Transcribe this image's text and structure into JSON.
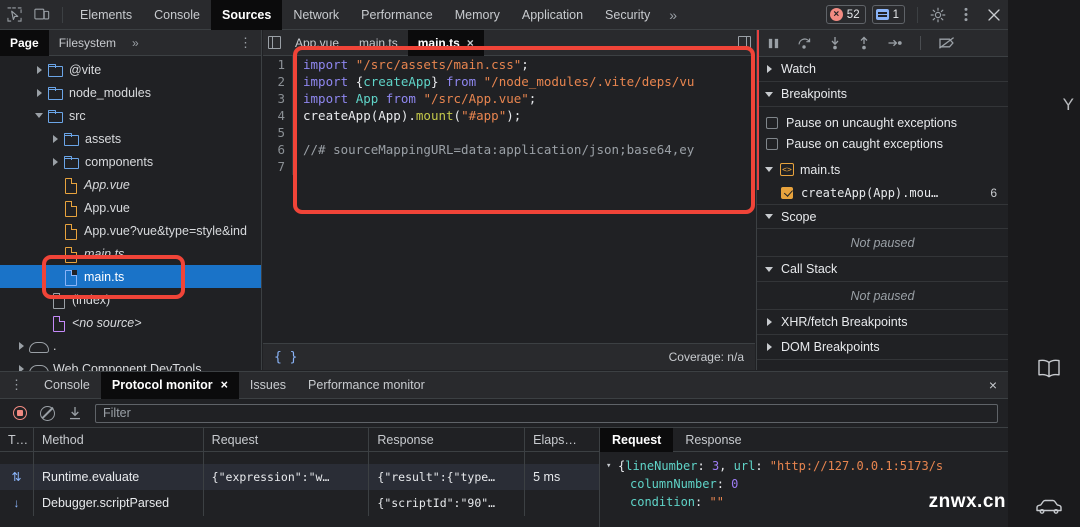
{
  "topbar": {
    "icons": [
      "inspect-icon",
      "device-toggle-icon"
    ],
    "tabs": [
      {
        "label": "Elements",
        "active": false
      },
      {
        "label": "Console",
        "active": false
      },
      {
        "label": "Sources",
        "active": true
      },
      {
        "label": "Network",
        "active": false
      },
      {
        "label": "Performance",
        "active": false
      },
      {
        "label": "Memory",
        "active": false
      },
      {
        "label": "Application",
        "active": false
      },
      {
        "label": "Security",
        "active": false
      }
    ],
    "more": "»",
    "error_count": "52",
    "message_count": "1",
    "settings_icon": "gear-icon",
    "menu_icon": "kebab-menu-icon",
    "close_icon": "close-icon"
  },
  "navigator": {
    "tabs": [
      {
        "label": "Page",
        "active": true
      },
      {
        "label": "Filesystem",
        "active": false
      }
    ],
    "more": "»",
    "menu": "⋮",
    "tree": [
      {
        "label": "@vite",
        "type": "folder",
        "arrow": "closed",
        "indent": 34,
        "selected": false,
        "italic": false
      },
      {
        "label": "node_modules",
        "type": "folder",
        "arrow": "closed",
        "indent": 34,
        "selected": false,
        "italic": false
      },
      {
        "label": "src",
        "type": "folder",
        "arrow": "open",
        "indent": 34,
        "selected": false,
        "italic": false
      },
      {
        "label": "assets",
        "type": "folder",
        "arrow": "closed",
        "indent": 50,
        "selected": false,
        "italic": false
      },
      {
        "label": "components",
        "type": "folder",
        "arrow": "closed",
        "indent": 50,
        "selected": false,
        "italic": false
      },
      {
        "label": "App.vue",
        "type": "doc-orange",
        "arrow": "none",
        "indent": 62,
        "selected": false,
        "italic": true
      },
      {
        "label": "App.vue",
        "type": "doc-orange",
        "arrow": "none",
        "indent": 62,
        "selected": false,
        "italic": false
      },
      {
        "label": "App.vue?vue&type=style&ind",
        "type": "doc-orange",
        "arrow": "none",
        "indent": 62,
        "selected": false,
        "italic": false
      },
      {
        "label": "main.ts",
        "type": "doc-orange",
        "arrow": "none",
        "indent": 62,
        "selected": false,
        "italic": true
      },
      {
        "label": "main.ts",
        "type": "doc-blue",
        "arrow": "none",
        "indent": 62,
        "selected": true,
        "italic": false
      },
      {
        "label": "(index)",
        "type": "doc-grey",
        "arrow": "none",
        "indent": 50,
        "selected": false,
        "italic": false
      },
      {
        "label": "<no source>",
        "type": "doc-purple",
        "arrow": "none",
        "indent": 50,
        "selected": false,
        "italic": true
      },
      {
        "label": ".",
        "type": "cloud",
        "arrow": "closed",
        "indent": 16,
        "selected": false,
        "italic": false
      },
      {
        "label": "Web Component DevTools",
        "type": "cloud",
        "arrow": "closed",
        "indent": 16,
        "selected": false,
        "italic": false
      }
    ]
  },
  "editor": {
    "nav_left_icon": "panel-left-icon",
    "nav_right_icon": "panel-right-icon",
    "tabs": [
      {
        "label": "App.vue",
        "active": false,
        "closable": false
      },
      {
        "label": "main.ts",
        "active": false,
        "closable": false
      },
      {
        "label": "main.ts",
        "active": true,
        "closable": true
      }
    ],
    "lines": [
      {
        "n": "1",
        "tokens": [
          {
            "t": "import ",
            "c": "kw"
          },
          {
            "t": "\"/src/assets/main.css\"",
            "c": "str"
          },
          {
            "t": ";",
            "c": "plain"
          }
        ]
      },
      {
        "n": "2",
        "tokens": [
          {
            "t": "import ",
            "c": "kw"
          },
          {
            "t": "{",
            "c": "plain"
          },
          {
            "t": "createApp",
            "c": "ident"
          },
          {
            "t": "} ",
            "c": "plain"
          },
          {
            "t": "from ",
            "c": "kw"
          },
          {
            "t": "\"/node_modules/.vite/deps/vu",
            "c": "str"
          }
        ]
      },
      {
        "n": "3",
        "tokens": [
          {
            "t": "import ",
            "c": "kw"
          },
          {
            "t": "App ",
            "c": "ident"
          },
          {
            "t": "from ",
            "c": "kw"
          },
          {
            "t": "\"/src/App.vue\"",
            "c": "str"
          },
          {
            "t": ";",
            "c": "plain"
          }
        ]
      },
      {
        "n": "4",
        "tokens": [
          {
            "t": "createApp(App).",
            "c": "plain"
          },
          {
            "t": "mount",
            "c": "fn"
          },
          {
            "t": "(",
            "c": "plain"
          },
          {
            "t": "\"#app\"",
            "c": "str"
          },
          {
            "t": ");",
            "c": "plain"
          }
        ]
      },
      {
        "n": "5",
        "tokens": []
      },
      {
        "n": "6",
        "tokens": [
          {
            "t": "//# sourceMappingURL=data:application/json;base64,ey",
            "c": "cmt"
          }
        ]
      },
      {
        "n": "7",
        "tokens": []
      }
    ],
    "format_icon": "pretty-print-icon",
    "coverage_text": "Coverage: n/a"
  },
  "debugger": {
    "toolbar_icons": [
      "resume-icon",
      "step-over-icon",
      "step-into-icon",
      "step-out-icon",
      "step-icon",
      "deactivate-breakpoints-icon"
    ],
    "sections": [
      {
        "title": "Watch",
        "state": "closed"
      },
      {
        "title": "Breakpoints",
        "state": "open"
      },
      {
        "title": "Scope",
        "state": "open"
      },
      {
        "title": "Call Stack",
        "state": "open"
      },
      {
        "title": "XHR/fetch Breakpoints",
        "state": "closed"
      },
      {
        "title": "DOM Breakpoints",
        "state": "closed"
      }
    ],
    "pause_uncaught": {
      "label": "Pause on uncaught exceptions",
      "checked": false
    },
    "pause_caught": {
      "label": "Pause on caught exceptions",
      "checked": false
    },
    "breakpoint_file": "main.ts",
    "breakpoint_item": {
      "label": "createApp(App).mou…",
      "line": "6",
      "checked": true
    },
    "scope_status": "Not paused",
    "callstack_status": "Not paused"
  },
  "drawer": {
    "menu": "⋮",
    "tabs": [
      {
        "label": "Console",
        "active": false,
        "closable": false
      },
      {
        "label": "Protocol monitor",
        "active": true,
        "closable": true
      },
      {
        "label": "Issues",
        "active": false,
        "closable": false
      },
      {
        "label": "Performance monitor",
        "active": false,
        "closable": false
      }
    ],
    "close_icon": "close-icon",
    "record_icon": "record-icon",
    "clear_icon": "clear-icon",
    "download_icon": "download-icon",
    "filter_placeholder": "Filter",
    "filter_value": "",
    "columns": [
      "T…",
      "Method",
      "Request",
      "Response",
      "Elaps…"
    ],
    "rows": [
      {
        "dir": "",
        "method": "",
        "request": "",
        "response": "",
        "elapsed": "",
        "partial": true,
        "highlight": false
      },
      {
        "dir": "⇅",
        "method": "Runtime.evaluate",
        "request": "{\"expression\":\"w…",
        "response": "{\"result\":{\"type…",
        "elapsed": "5 ms",
        "partial": false,
        "highlight": true
      },
      {
        "dir": "↓",
        "method": "Debugger.scriptParsed",
        "request": "",
        "response": "{\"scriptId\":\"90\"…",
        "elapsed": "",
        "partial": false,
        "highlight": false
      }
    ],
    "detail_tabs": [
      {
        "label": "Request",
        "active": true
      },
      {
        "label": "Response",
        "active": false
      }
    ],
    "detail_lines": [
      {
        "tri": "▾",
        "indent": 0,
        "tokens": [
          {
            "t": "{",
            "c": "jp"
          },
          {
            "t": "lineNumber",
            "c": "jk"
          },
          {
            "t": ": ",
            "c": "jp"
          },
          {
            "t": "3",
            "c": "jn"
          },
          {
            "t": ", ",
            "c": "jp"
          },
          {
            "t": "url",
            "c": "jk"
          },
          {
            "t": ": ",
            "c": "jp"
          },
          {
            "t": "\"http://127.0.0.1:5173/s",
            "c": "js"
          }
        ]
      },
      {
        "tri": "",
        "indent": 1,
        "tokens": [
          {
            "t": "columnNumber",
            "c": "jk"
          },
          {
            "t": ": ",
            "c": "jp"
          },
          {
            "t": "0",
            "c": "jn"
          }
        ]
      },
      {
        "tri": "",
        "indent": 1,
        "tokens": [
          {
            "t": "condition",
            "c": "jk"
          },
          {
            "t": ": ",
            "c": "jp"
          },
          {
            "t": "\"\"",
            "c": "js"
          }
        ]
      }
    ]
  },
  "rail": {
    "letter": "Y",
    "book_icon": "book-icon",
    "car_icon": "car-icon"
  },
  "watermark": "znwx.cn",
  "colors": {
    "background": "#202124",
    "toolbar": "#292a2d",
    "selection_blue": "#1a73c8",
    "accent_blue": "#8ab4f8",
    "error_red": "#f28b82",
    "annotation_red": "#f04438",
    "folder_blue": "#6ba5e7",
    "file_orange": "#e8a33d"
  }
}
